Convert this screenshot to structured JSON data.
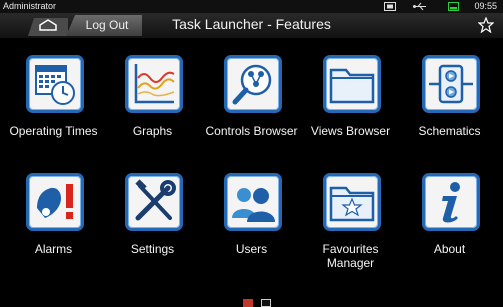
{
  "status_bar": {
    "user": "Administrator",
    "time": "09:55"
  },
  "header": {
    "title": "Task Launcher - Features",
    "logout_label": "Log Out"
  },
  "tiles": [
    {
      "label": "Operating Times",
      "icon": "calendar-clock-icon"
    },
    {
      "label": "Graphs",
      "icon": "line-graph-icon"
    },
    {
      "label": "Controls Browser",
      "icon": "controls-browser-icon"
    },
    {
      "label": "Views Browser",
      "icon": "folder-icon"
    },
    {
      "label": "Schematics",
      "icon": "schematic-icon"
    },
    {
      "label": "Alarms",
      "icon": "alarm-bell-icon"
    },
    {
      "label": "Settings",
      "icon": "tools-icon"
    },
    {
      "label": "Users",
      "icon": "users-icon"
    },
    {
      "label": "Favourites Manager",
      "icon": "favourites-folder-icon"
    },
    {
      "label": "About",
      "icon": "info-icon"
    }
  ],
  "pagination": {
    "pages": 2,
    "current": 1,
    "active_color": "#c0392b"
  },
  "colors": {
    "tile_border": "#2569b5",
    "icon_blue": "#1f5fa8"
  }
}
